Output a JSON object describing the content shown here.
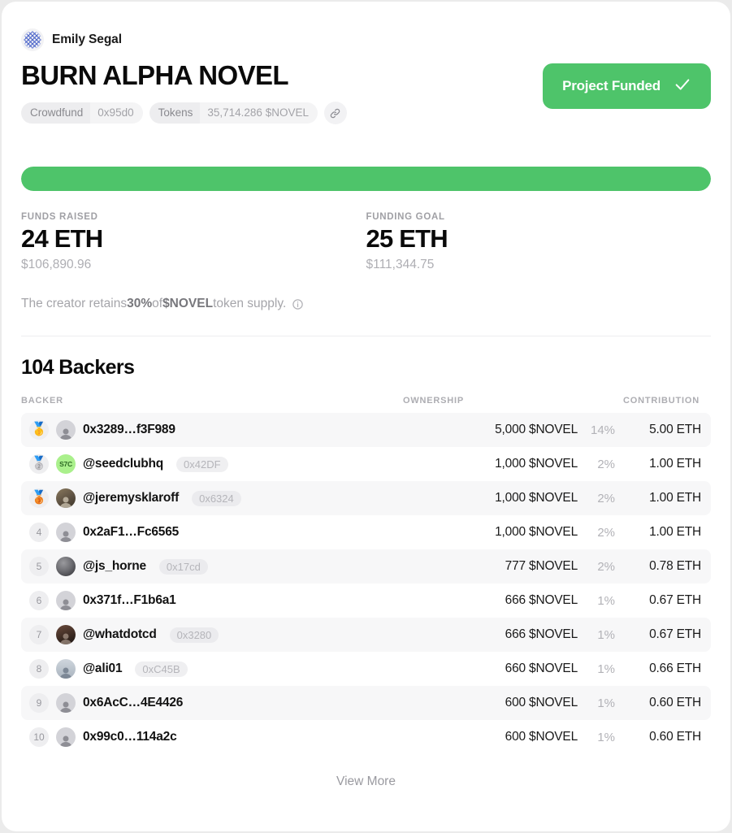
{
  "colors": {
    "accent_green": "#4ec46a",
    "card_bg": "#ffffff",
    "page_bg": "#ebebeb",
    "row_alt": "#f7f7f8",
    "muted_text": "#a5a5aa"
  },
  "header": {
    "creator_name": "Emily Segal",
    "creator_avatar_icon": "woven-knot-avatar",
    "project_title": "BURN ALPHA NOVEL",
    "pills": [
      {
        "label": "Crowdfund",
        "value": "0x95d0"
      },
      {
        "label": "Tokens",
        "value": "35,714.286 $NOVEL"
      }
    ],
    "link_icon": "chain-link-icon",
    "funded_badge": {
      "label": "Project Funded",
      "icon": "check-icon"
    }
  },
  "progress": {
    "percent": 100
  },
  "stats": [
    {
      "label": "FUNDS RAISED",
      "value": "24 ETH",
      "sub": "$106,890.96"
    },
    {
      "label": "FUNDING GOAL",
      "value": "25 ETH",
      "sub": "$111,344.75"
    }
  ],
  "note": {
    "prefix": "The creator retains ",
    "percent": "30%",
    "middle": " of ",
    "token": "$NOVEL",
    "suffix": " token supply.",
    "info_icon": "info-circle-icon"
  },
  "backers": {
    "title": "104 Backers",
    "columns": {
      "backer": "BACKER",
      "ownership": "OWNERSHIP",
      "contribution": "CONTRIBUTION"
    },
    "rows": [
      {
        "rank": "🥇",
        "rank_is_medal": true,
        "avatar": "default-person",
        "name": "0x3289…f3F989",
        "address": "",
        "tokens": "5,000 $NOVEL",
        "pct": "14%",
        "eth": "5.00 ETH"
      },
      {
        "rank": "🥈",
        "rank_is_medal": true,
        "avatar": "seedclub",
        "name": "@seedclubhq",
        "address": "0x42DF",
        "tokens": "1,000 $NOVEL",
        "pct": "2%",
        "eth": "1.00 ETH"
      },
      {
        "rank": "🥉",
        "rank_is_medal": true,
        "avatar": "jeremy",
        "name": "@jeremysklaroff",
        "address": "0x6324",
        "tokens": "1,000 $NOVEL",
        "pct": "2%",
        "eth": "1.00 ETH"
      },
      {
        "rank": "4",
        "rank_is_medal": false,
        "avatar": "default-person",
        "name": "0x2aF1…Fc6565",
        "address": "",
        "tokens": "1,000 $NOVEL",
        "pct": "2%",
        "eth": "1.00 ETH"
      },
      {
        "rank": "5",
        "rank_is_medal": false,
        "avatar": "jshorne",
        "name": "@js_horne",
        "address": "0x17cd",
        "tokens": "777 $NOVEL",
        "pct": "2%",
        "eth": "0.78 ETH"
      },
      {
        "rank": "6",
        "rank_is_medal": false,
        "avatar": "default-person",
        "name": "0x371f…F1b6a1",
        "address": "",
        "tokens": "666 $NOVEL",
        "pct": "1%",
        "eth": "0.67 ETH"
      },
      {
        "rank": "7",
        "rank_is_medal": false,
        "avatar": "whatdot",
        "name": "@whatdotcd",
        "address": "0x3280",
        "tokens": "666 $NOVEL",
        "pct": "1%",
        "eth": "0.67 ETH"
      },
      {
        "rank": "8",
        "rank_is_medal": false,
        "avatar": "ali",
        "name": "@ali01",
        "address": "0xC45B",
        "tokens": "660 $NOVEL",
        "pct": "1%",
        "eth": "0.66 ETH"
      },
      {
        "rank": "9",
        "rank_is_medal": false,
        "avatar": "default-person",
        "name": "0x6AcC…4E4426",
        "address": "",
        "tokens": "600 $NOVEL",
        "pct": "1%",
        "eth": "0.60 ETH"
      },
      {
        "rank": "10",
        "rank_is_medal": false,
        "avatar": "default-person",
        "name": "0x99c0…114a2c",
        "address": "",
        "tokens": "600 $NOVEL",
        "pct": "1%",
        "eth": "0.60 ETH"
      }
    ],
    "view_more": "View More"
  }
}
